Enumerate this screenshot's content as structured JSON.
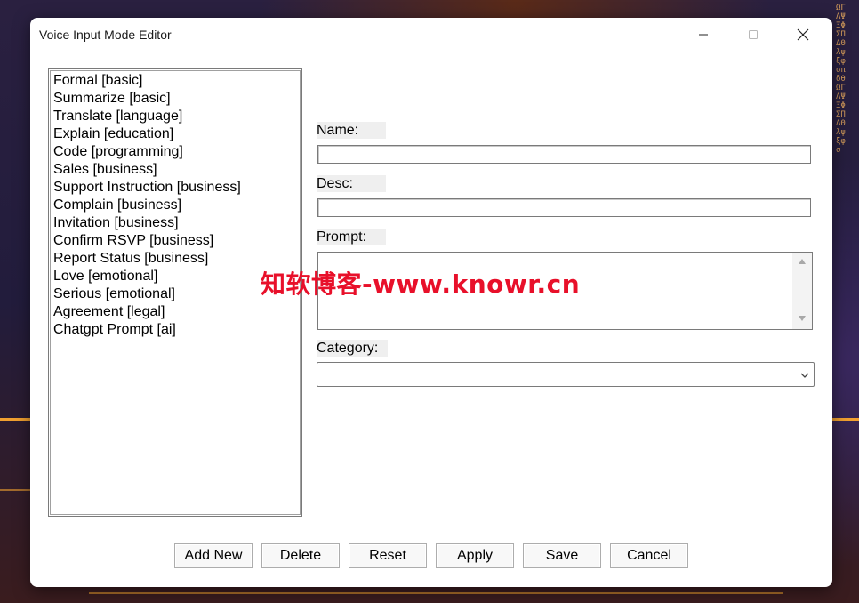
{
  "window": {
    "title": "Voice Input Mode Editor"
  },
  "modes_list": [
    "Formal [basic]",
    "Summarize [basic]",
    "Translate [language]",
    "Explain [education]",
    "Code [programming]",
    "Sales [business]",
    "Support Instruction [business]",
    "Complain [business]",
    "Invitation [business]",
    "Confirm RSVP [business]",
    "Report Status [business]",
    "Love [emotional]",
    "Serious [emotional]",
    "Agreement [legal]",
    "Chatgpt Prompt [ai]"
  ],
  "form": {
    "name_label": "Name:",
    "name_value": "",
    "desc_label": "Desc:",
    "desc_value": "",
    "prompt_label": "Prompt:",
    "prompt_value": "",
    "category_label": "Category:",
    "category_value": ""
  },
  "buttons": {
    "add_new": "Add New",
    "delete": "Delete",
    "reset": "Reset",
    "apply": "Apply",
    "save": "Save",
    "cancel": "Cancel"
  },
  "watermark": "知软博客-www.knowr.cn",
  "background_glyphs": "ΩΓΛΨΞΦΣΠΔΘλψξφσπδθΩΓΛΨΞΦΣΠΔΘλψξφσ",
  "colors": {
    "watermark": "#e8102a",
    "window_bg": "#ffffff",
    "label_bg": "#efefef",
    "desktop_accent": "#f0a030"
  },
  "icons": {
    "minimize": "minimize-icon",
    "maximize": "maximize-icon",
    "close": "close-icon",
    "scroll_up": "scroll-up-arrow-icon",
    "scroll_down": "scroll-down-arrow-icon",
    "dropdown": "chevron-down-icon"
  }
}
